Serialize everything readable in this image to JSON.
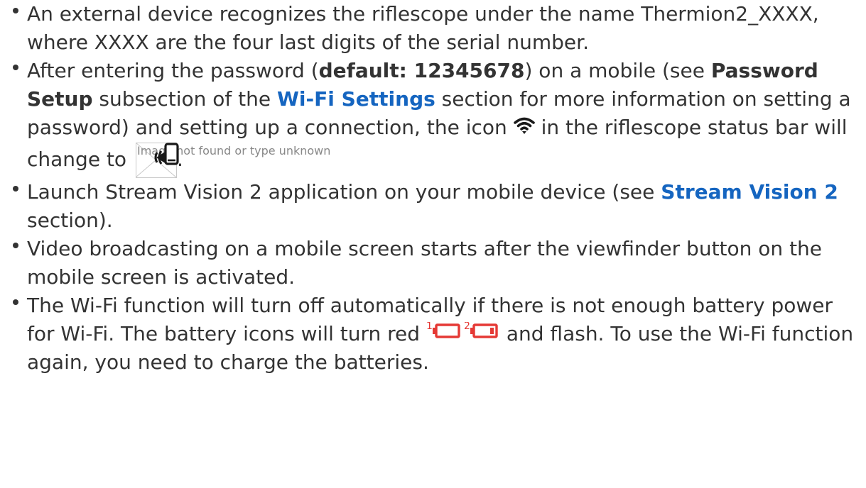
{
  "items": [
    {
      "text": "An external device recognizes the riflescope under the name Thermion2_XXXX, where XXXX are the four last digits of the serial number."
    },
    {
      "t1": "After entering the password (",
      "bold1": "default: 12345678",
      "t2": ") on a mobile (see ",
      "bold2": "Password Setup",
      "t3": " subsection of the ",
      "link1": "Wi-Fi Settings",
      "t4": " section for more information on setting a password) and setting up a connection, the icon ",
      "icon1": "wifi-icon",
      "t5": " in the riflescope status bar will change to ",
      "broken_alt": "Image not found or type unknown",
      "icon2": "phone-connected-icon",
      "t6": "."
    },
    {
      "t1": "Launch Stream Vision 2 application on your mobile device (see ",
      "link1": "Stream Vision 2",
      "t2": " section)."
    },
    {
      "text": "Video broadcasting on a mobile screen starts after the viewfinder button on the mobile screen is activated."
    },
    {
      "t1": "The Wi-Fi function will turn off automatically if there is not enough battery power for Wi-Fi. The battery icons will turn red ",
      "battery1_label": "1",
      "battery2_label": "2",
      "icon": "battery-low-icon",
      "t2": " and flash. To use the Wi-Fi function again, you need to charge the batteries."
    }
  ],
  "colors": {
    "text": "#333333",
    "link": "#1565c0",
    "battery_warning": "#e53935"
  }
}
